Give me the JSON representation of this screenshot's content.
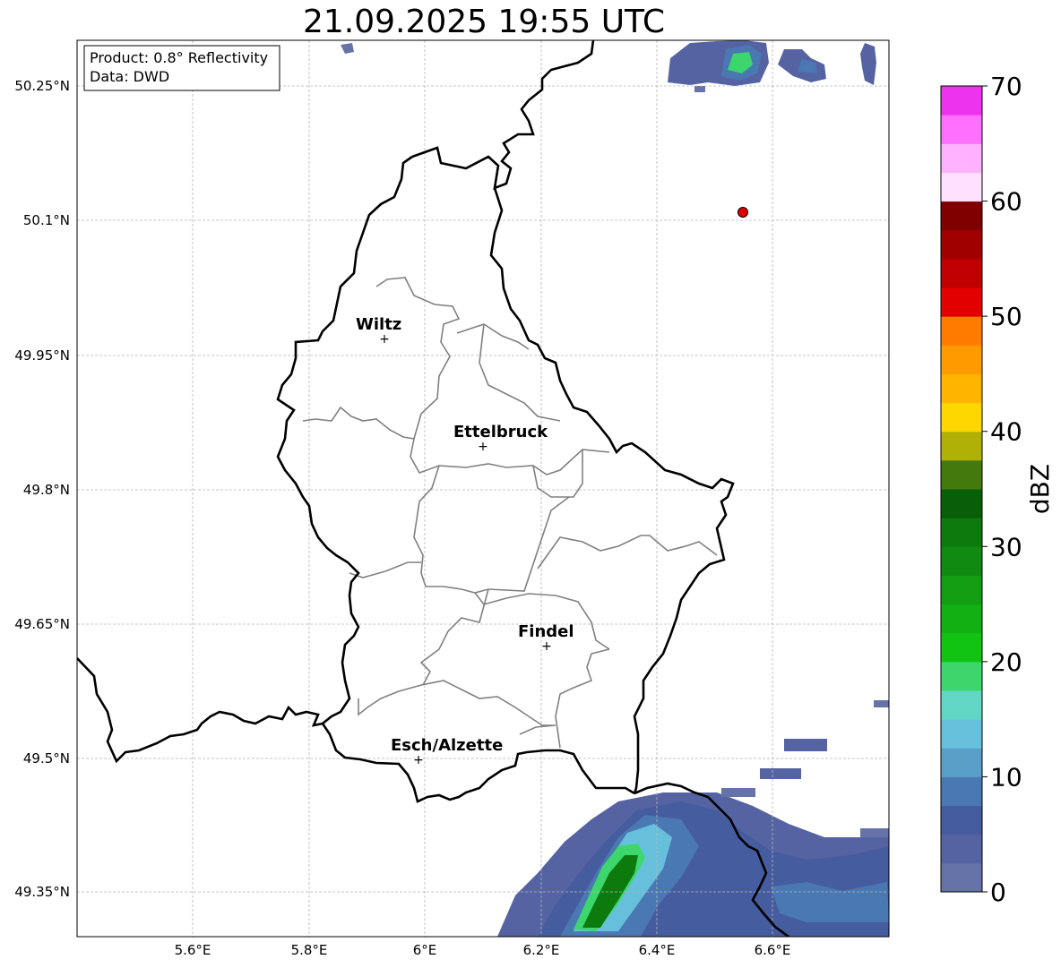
{
  "title": "21.09.2025 19:55 UTC",
  "info_box": {
    "line1": "Product: 0.8° Reflectivity",
    "line2": "Data: DWD"
  },
  "lat_ticks": [
    "50.25°N",
    "50.1°N",
    "49.95°N",
    "49.8°N",
    "49.65°N",
    "49.5°N",
    "49.35°N"
  ],
  "lon_ticks": [
    "5.6°E",
    "5.8°E",
    "6°E",
    "6.2°E",
    "6.4°E",
    "6.6°E"
  ],
  "cities": [
    {
      "name": "Wiltz"
    },
    {
      "name": "Ettelbruck"
    },
    {
      "name": "Findel"
    },
    {
      "name": "Esch/Alzette"
    }
  ],
  "colorbar": {
    "unit": "dBZ",
    "tick_labels": [
      "0",
      "10",
      "20",
      "30",
      "40",
      "50",
      "60",
      "70"
    ],
    "colors": [
      "#6673a8",
      "#5563a2",
      "#455c9f",
      "#4a78b3",
      "#5a9fc8",
      "#67c0db",
      "#62d6c4",
      "#3dd66c",
      "#12c412",
      "#12b012",
      "#139e13",
      "#108a10",
      "#0d7a0d",
      "#095f09",
      "#447a0d",
      "#b0b007",
      "#ffd700",
      "#ffb500",
      "#ff9a00",
      "#ff7c00",
      "#e20000",
      "#c00000",
      "#a00000",
      "#800000",
      "#ffe0ff",
      "#ffb2ff",
      "#ff70ff",
      "#ee33ee"
    ]
  },
  "marker": {
    "color": "#e00000"
  }
}
